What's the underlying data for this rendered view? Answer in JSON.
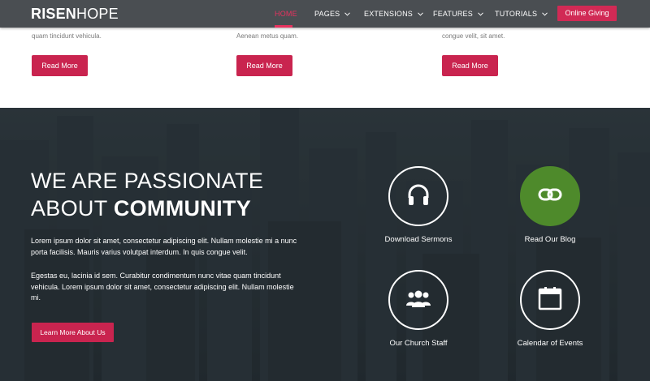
{
  "header": {
    "logo_bold": "RISEN",
    "logo_light": "HOPE",
    "nav": [
      {
        "label": "HOME",
        "dropdown": false,
        "active": true
      },
      {
        "label": "PAGES",
        "dropdown": true
      },
      {
        "label": "EXTENSIONS",
        "dropdown": true
      },
      {
        "label": "FEATURES",
        "dropdown": true
      },
      {
        "label": "TUTORIALS",
        "dropdown": true
      }
    ],
    "cta": "Online Giving"
  },
  "cards": [
    {
      "text": "quam tincidunt vehicula.",
      "button": "Read More"
    },
    {
      "text": "Aenean metus quam.",
      "button": "Read More"
    },
    {
      "text": "congue velit, sit amet.",
      "button": "Read More"
    }
  ],
  "community": {
    "headline_line1": "WE ARE PASSIONATE",
    "headline_line2_light": "ABOUT ",
    "headline_line2_bold": "COMMUNITY",
    "paragraph1": "Lorem ipsum dolor sit amet, consectetur adipiscing elit. Nullam molestie mi a nunc porta facilisis. Mauris varius volutpat interdum. In quis congue velit.",
    "paragraph2": "Egestas eu, lacinia id sem. Curabitur condimentum nunc vitae quam tincidunt vehicula. Lorem ipsum dolor sit amet, consectetur adipiscing elit. Nullam molestie mi.",
    "button": "Learn More About Us"
  },
  "features": [
    {
      "label": "Download Sermons",
      "icon": "headphones-icon"
    },
    {
      "label": "Read Our Blog",
      "icon": "link-icon"
    },
    {
      "label": "Our Church Staff",
      "icon": "users-icon"
    },
    {
      "label": "Calendar of Events",
      "icon": "calendar-icon"
    }
  ],
  "colors": {
    "accent": "#c9244f",
    "active_nav": "#e8325f",
    "header_bg": "#4a4e52",
    "blog_circle": "#4e8a2b"
  }
}
